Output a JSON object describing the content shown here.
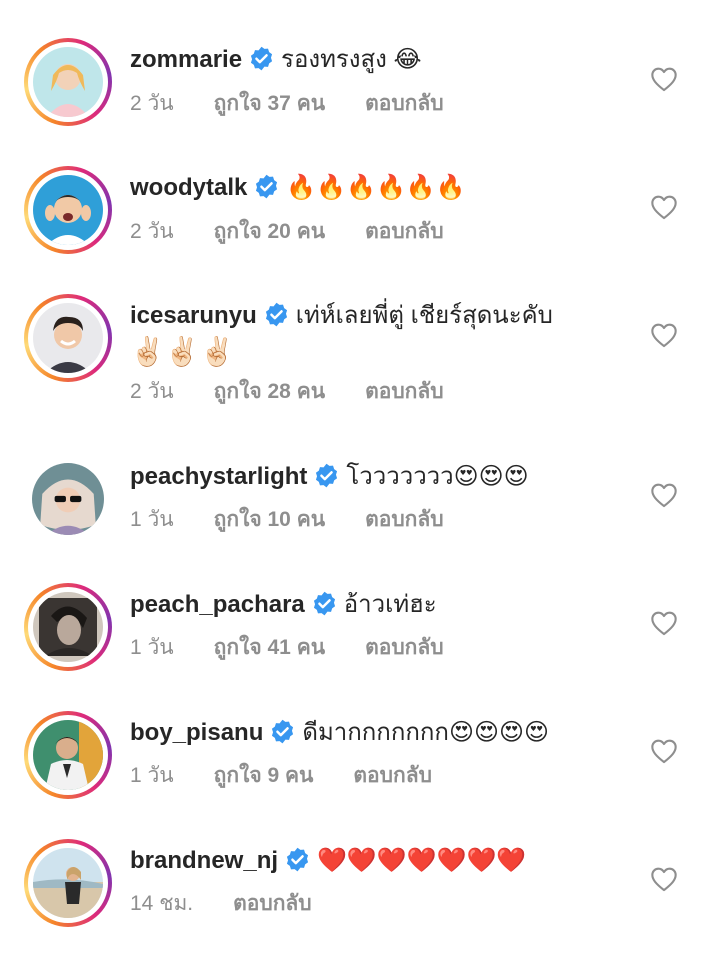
{
  "comments": [
    {
      "username": "zommarie",
      "text": "รองทรงสูง 😂",
      "text2": "",
      "time": "2 วัน",
      "likes": "ถูกใจ 37 คน",
      "reply": "ตอบกลับ",
      "avatar_icon": "avatar-zommarie",
      "ring": true
    },
    {
      "username": "woodytalk",
      "text": "🔥🔥🔥🔥🔥🔥",
      "text2": "",
      "time": "2 วัน",
      "likes": "ถูกใจ 20 คน",
      "reply": "ตอบกลับ",
      "avatar_icon": "avatar-woodytalk",
      "ring": true
    },
    {
      "username": "icesarunyu",
      "text": "เท่ห์เลยพี่ตู่ เชียร์สุดนะคับ",
      "text2": "✌🏻✌🏻✌🏻",
      "time": "2 วัน",
      "likes": "ถูกใจ 28 คน",
      "reply": "ตอบกลับ",
      "avatar_icon": "avatar-icesarunyu",
      "ring": true
    },
    {
      "username": "peachystarlight",
      "text": "โววววววว😍😍😍",
      "text2": "",
      "time": "1 วัน",
      "likes": "ถูกใจ 10 คน",
      "reply": "ตอบกลับ",
      "avatar_icon": "avatar-peachystarlight",
      "ring": false
    },
    {
      "username": "peach_pachara",
      "text": "อ้าวเท่ฮะ",
      "text2": "",
      "time": "1 วัน",
      "likes": "ถูกใจ 41 คน",
      "reply": "ตอบกลับ",
      "avatar_icon": "avatar-peach_pachara",
      "ring": true
    },
    {
      "username": "boy_pisanu",
      "text": "ดีมากกกกกกก😍😍😍😍",
      "text2": "",
      "time": "1 วัน",
      "likes": "ถูกใจ 9 คน",
      "reply": "ตอบกลับ",
      "avatar_icon": "avatar-boy_pisanu",
      "ring": true
    },
    {
      "username": "brandnew_nj",
      "text": "❤️❤️❤️❤️❤️❤️❤️",
      "text2": "",
      "time": "14 ชม.",
      "likes": "",
      "reply": "ตอบกลับ",
      "avatar_icon": "avatar-brandnew_nj",
      "ring": true
    }
  ],
  "icons": {
    "verified": "verified-badge-icon",
    "like": "heart-outline-icon"
  },
  "colors": {
    "text": "#262626",
    "meta": "#8e8e8e",
    "verified": "#3897f0",
    "ring_start": "#f58529",
    "ring_end": "#dd2a7b"
  }
}
